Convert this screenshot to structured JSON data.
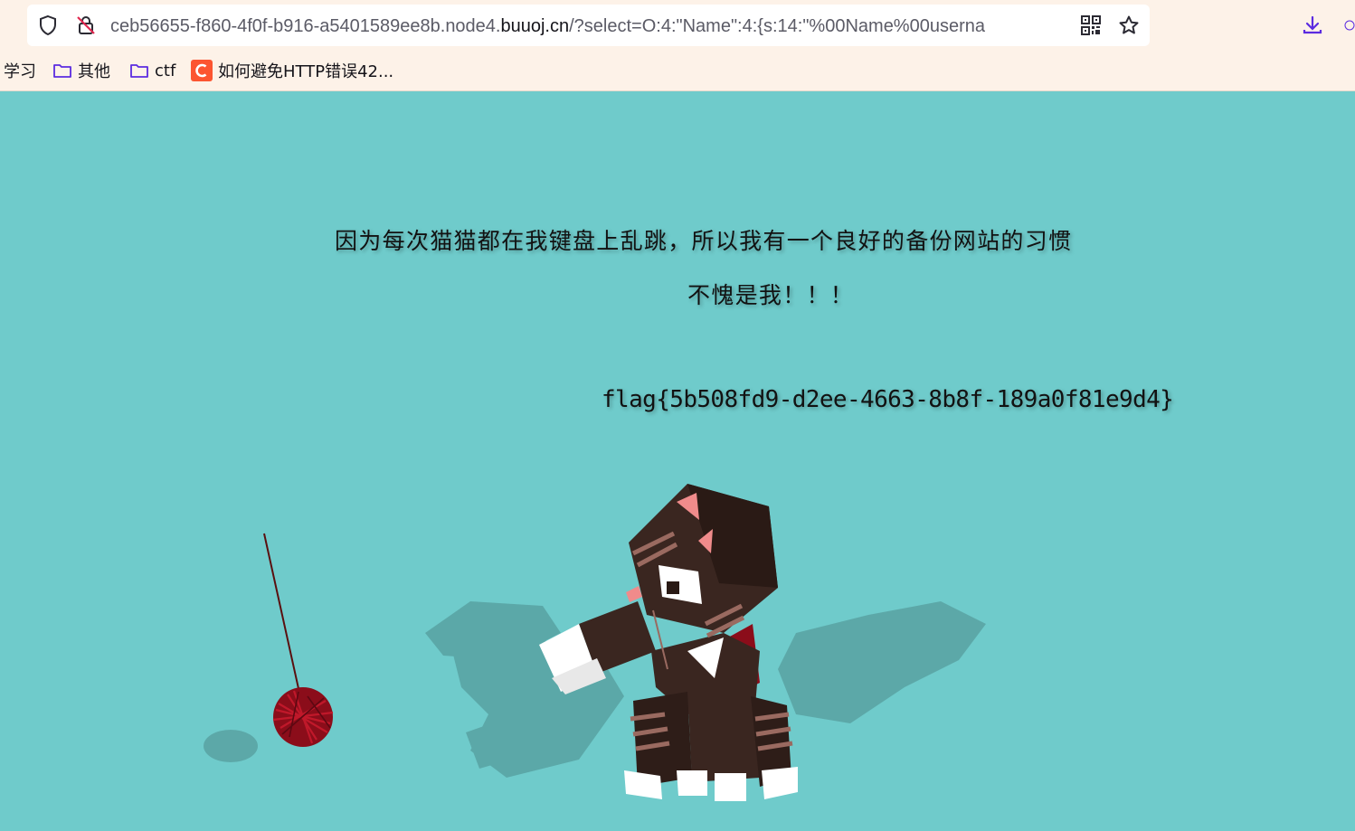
{
  "browser": {
    "url_prefix": "ceb56655-f860-4f0f-b916-a5401589ee8b.node4.",
    "url_host": "buuoj.cn",
    "url_suffix": "/?select=O:4:\"Name\":4:{s:14:\"%00Name%00userna",
    "icons": {
      "tracking": "shield-icon",
      "security": "insecure-lock-icon",
      "qr": "qr-code-icon",
      "bookmark": "star-icon",
      "downloads": "download-icon"
    },
    "accent_color": "#5b2be0"
  },
  "bookmarks": [
    {
      "label": "学习",
      "icon": "none"
    },
    {
      "label": "其他",
      "icon": "folder-icon"
    },
    {
      "label": "ctf",
      "icon": "folder-icon"
    },
    {
      "label": "如何避免HTTP错误42...",
      "icon": "csdn-logo-icon"
    }
  ],
  "page": {
    "background_color": "#6fcbcb",
    "line1": "因为每次猫猫都在我键盘上乱跳，所以我有一个良好的备份网站的习惯",
    "line2": "不愧是我！！！",
    "flag": "flag{5b508fd9-d2ee-4663-8b8f-189a0f81e9d4}"
  }
}
